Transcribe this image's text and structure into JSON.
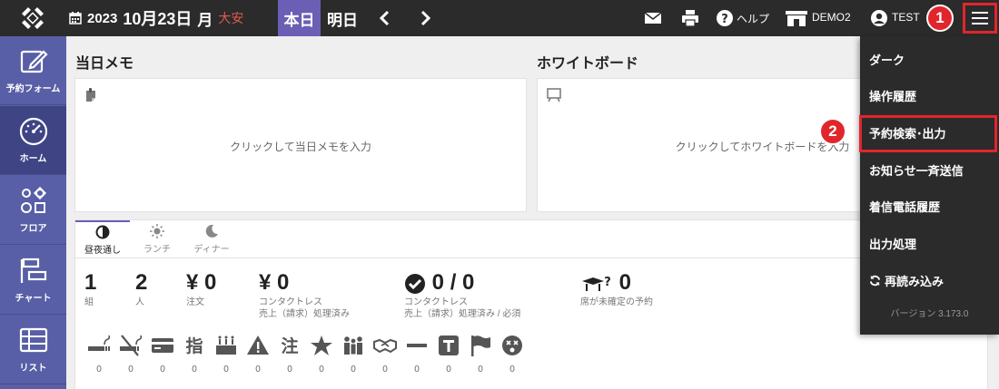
{
  "topbar": {
    "year": "2023",
    "month_day": "10月23日",
    "dow": "月",
    "rokuyo": "大安",
    "today_label": "本日",
    "tomorrow_label": "明日",
    "help_label": "ヘルプ",
    "store_label": "DEMO2",
    "user_label": "TEST"
  },
  "sidebar": {
    "items": [
      {
        "label": "予約フォーム",
        "icon": "edit-icon"
      },
      {
        "label": "ホーム",
        "icon": "dashboard-icon"
      },
      {
        "label": "フロア",
        "icon": "floor-icon"
      },
      {
        "label": "チャート",
        "icon": "chart-icon"
      },
      {
        "label": "リスト",
        "icon": "list-icon"
      }
    ]
  },
  "memo": {
    "title": "当日メモ",
    "placeholder": "クリックして当日メモを入力"
  },
  "whiteboard": {
    "title": "ホワイトボード",
    "placeholder": "クリックしてホワイトボードを入力"
  },
  "tabs": [
    {
      "label": "昼夜通し"
    },
    {
      "label": "ランチ"
    },
    {
      "label": "ディナー"
    }
  ],
  "stats": {
    "groups": {
      "value": "1",
      "label": "組"
    },
    "people": {
      "value": "2",
      "label": "人"
    },
    "orders": {
      "value": "¥ 0",
      "label": "注文"
    },
    "contactless": {
      "value": "¥ 0",
      "label1": "コンタクトレス",
      "label2": "売上（請求）処理済み"
    },
    "contactless_required": {
      "value": "0 / 0",
      "label1": "コンタクトレス",
      "label2": "売上（請求）処理済み / 必須"
    },
    "unconfirmed": {
      "value": "0",
      "label": "席が未確定の予約"
    }
  },
  "icon_counts": [
    "0",
    "0",
    "0",
    "0",
    "0",
    "0",
    "0",
    "0",
    "0",
    "0",
    "0",
    "0",
    "0",
    "0"
  ],
  "menu": {
    "items": [
      "ダーク",
      "操作履歴",
      "予約検索･出力",
      "お知らせ一斉送信",
      "着信電話履歴",
      "出力処理",
      "再読み込み"
    ],
    "version": "バージョン 3.173.0"
  },
  "badges": {
    "first": "1",
    "second": "2"
  }
}
